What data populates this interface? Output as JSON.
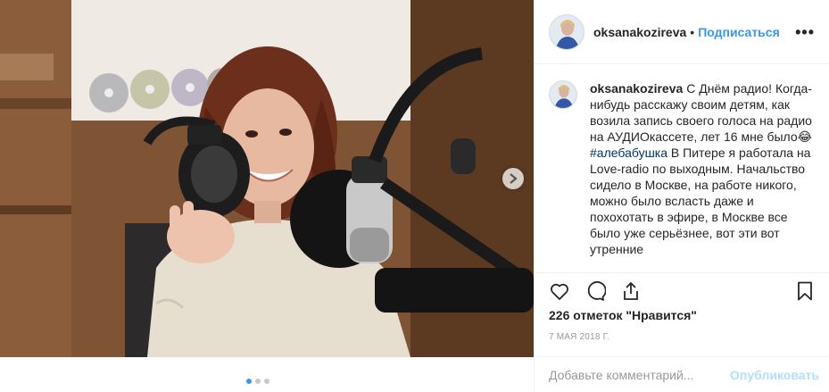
{
  "post": {
    "username": "oksanakozireva",
    "separator": "•",
    "follow_label": "Подписаться",
    "more_label": "•••"
  },
  "caption": {
    "username": "oksanakozireva",
    "text_1": "С Днём радио! Когда-нибудь расскажу своим детям, как возила запись своего голоса на радио на АУДИОкассете, лет 16 мне было😂",
    "hashtag": "#алебабушка",
    "text_2": " В Питере я работала на Love-radio по выходным. Начальство сидело в Москве, на работе никого, можно было всласть даже и похохотать в эфире, в Москве все было уже серьёзнее, вот эти вот утренние"
  },
  "actions": {
    "like_icon": "heart-icon",
    "comment_icon": "speech-bubble-icon",
    "share_icon": "share-icon",
    "save_icon": "bookmark-icon"
  },
  "likes_text": "226 отметок \"Нравится\"",
  "date_text": "7 МАЯ 2018 Г.",
  "comment": {
    "placeholder": "Добавьте комментарий...",
    "publish_label": "Опубликовать"
  },
  "carousel": {
    "next_icon": "chevron-right-icon",
    "total_slides": 3,
    "active_slide": 1
  },
  "colors": {
    "link_blue": "#3897f0",
    "publish_disabled": "#b2dffc",
    "hashtag": "#003569"
  }
}
